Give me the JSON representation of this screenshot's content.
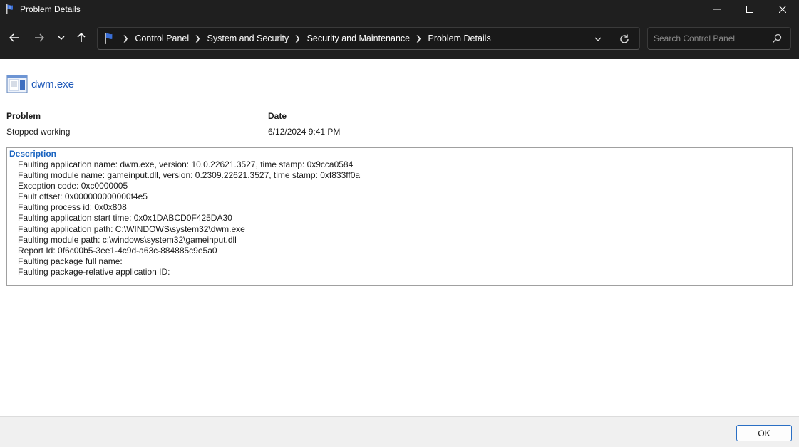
{
  "window": {
    "title": "Problem Details",
    "controls": [
      "minimize",
      "maximize",
      "close"
    ]
  },
  "nav": {
    "back_icon": "arrow-left-icon",
    "forward_icon": "arrow-right-icon",
    "recent_icon": "chevron-down-icon",
    "up_icon": "arrow-up-icon",
    "breadcrumbs": [
      "Control Panel",
      "System and Security",
      "Security and Maintenance",
      "Problem Details"
    ],
    "search_placeholder": "Search Control Panel"
  },
  "problem": {
    "app_name": "dwm.exe",
    "problem_header": "Problem",
    "problem_value": "Stopped working",
    "date_header": "Date",
    "date_value": "6/12/2024 9:41 PM"
  },
  "description": {
    "title": "Description",
    "lines": [
      "Faulting application name: dwm.exe, version: 10.0.22621.3527, time stamp: 0x9cca0584",
      "Faulting module name: gameinput.dll, version: 0.2309.22621.3527, time stamp: 0xf833ff0a",
      "Exception code: 0xc0000005",
      "Fault offset: 0x000000000000f4e5",
      "Faulting process id: 0x0x808",
      "Faulting application start time: 0x0x1DABCD0F425DA30",
      "Faulting application path: C:\\WINDOWS\\system32\\dwm.exe",
      "Faulting module path: c:\\windows\\system32\\gameinput.dll",
      "Report Id: 0f6c00b5-3ee1-4c9d-a63c-884885c9e5a0",
      "Faulting package full name: ",
      "Faulting package-relative application ID: "
    ]
  },
  "footer": {
    "ok_label": "OK"
  },
  "colors": {
    "chrome_bg": "#1f1f1f",
    "link_blue": "#1a56b8",
    "accent_blue": "#2a6fc4"
  }
}
